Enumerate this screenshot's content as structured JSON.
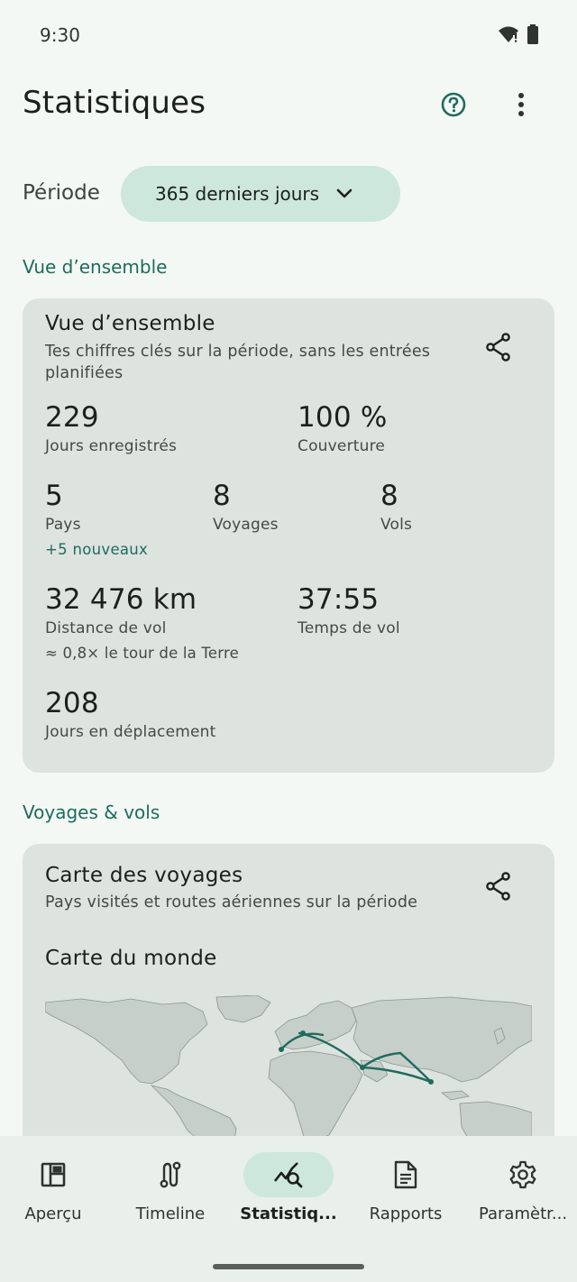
{
  "status_bar": {
    "time": "9:30",
    "icons": [
      "wifi-icon",
      "battery-icon"
    ]
  },
  "app_bar": {
    "title": "Statistiques",
    "actions": [
      "help-icon",
      "more-vert-icon"
    ]
  },
  "period": {
    "label": "Période",
    "selected": "365 derniers jours"
  },
  "sections": {
    "overview": "Vue d’ensemble",
    "trips": "Voyages & vols"
  },
  "overview_card": {
    "title": "Vue d’ensemble",
    "subtitle": "Tes chiffres clés sur la période, sans les entrées planifiées",
    "stats": {
      "days_recorded": {
        "value": "229",
        "label": "Jours enregistrés"
      },
      "coverage": {
        "value": "100 %",
        "label": "Couverture"
      },
      "countries": {
        "value": "5",
        "label": "Pays",
        "note": "+5 nouveaux"
      },
      "trips": {
        "value": "8",
        "label": "Voyages"
      },
      "flights": {
        "value": "8",
        "label": "Vols"
      },
      "flight_distance": {
        "value": "32 476 km",
        "label": "Distance de vol",
        "note": "≈ 0,8× le tour de la Terre"
      },
      "flight_time": {
        "value": "37:55",
        "label": "Temps de vol"
      },
      "days_traveling": {
        "value": "208",
        "label": "Jours en déplacement"
      }
    }
  },
  "map_card": {
    "title": "Carte des voyages",
    "subtitle": "Pays visités et routes aériennes sur la période",
    "map_title": "Carte du monde"
  },
  "bottom_nav": {
    "items": [
      {
        "label": "Aperçu",
        "icon": "dashboard-icon",
        "active": false
      },
      {
        "label": "Timeline",
        "icon": "route-icon",
        "active": false
      },
      {
        "label": "Statistiq...",
        "icon": "query-stats-icon",
        "active": true
      },
      {
        "label": "Rapports",
        "icon": "document-icon",
        "active": false
      },
      {
        "label": "Paramètr...",
        "icon": "settings-icon",
        "active": false
      }
    ]
  },
  "colors": {
    "background": "#f3f8f4",
    "card": "#dde3df",
    "accent": "#1f6b5e",
    "chip": "#cde7dc",
    "nav": "#e9efeb"
  }
}
